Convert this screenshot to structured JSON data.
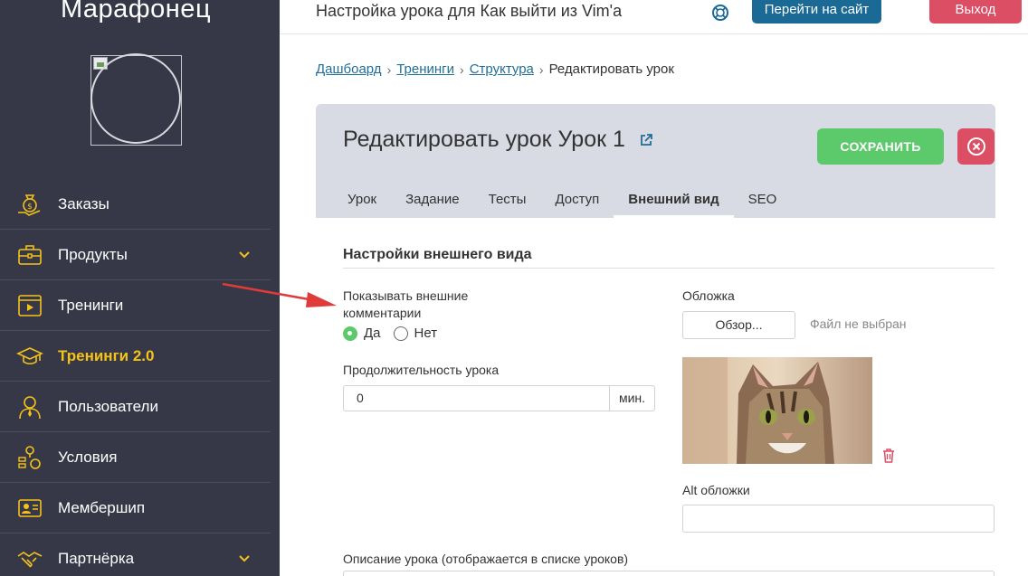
{
  "sidebar": {
    "brand": "Марафонец",
    "items": [
      {
        "label": "Заказы",
        "icon": "money-bag-icon",
        "active": false,
        "expandable": false
      },
      {
        "label": "Продукты",
        "icon": "briefcase-icon",
        "active": false,
        "expandable": true
      },
      {
        "label": "Тренинги",
        "icon": "video-player-icon",
        "active": false,
        "expandable": false
      },
      {
        "label": "Тренинги 2.0",
        "icon": "graduation-cap-icon",
        "active": true,
        "expandable": false
      },
      {
        "label": "Пользователи",
        "icon": "user-icon",
        "active": false,
        "expandable": false
      },
      {
        "label": "Условия",
        "icon": "conditions-icon",
        "active": false,
        "expandable": false
      },
      {
        "label": "Мембершип",
        "icon": "id-card-icon",
        "active": false,
        "expandable": false
      },
      {
        "label": "Партнёрка",
        "icon": "handshake-icon",
        "active": false,
        "expandable": true
      }
    ]
  },
  "topbar": {
    "title": "Настройка урока для Как выйти из Vim'a",
    "site_button": "Перейти на сайт",
    "exit_button": "Выход"
  },
  "breadcrumb": {
    "items": [
      "Дашбоард",
      "Тренинги",
      "Структура"
    ],
    "current": "Редактировать урок"
  },
  "card": {
    "title": "Редактировать урок Урок 1",
    "save_button": "СОХРАНИТЬ",
    "tabs": [
      "Урок",
      "Задание",
      "Тесты",
      "Доступ",
      "Внешний вид",
      "SEO"
    ],
    "active_tab": "Внешний вид"
  },
  "form": {
    "section_title": "Настройки внешнего вида",
    "comments_label_line1": "Показывать внешние",
    "comments_label_line2": "комментарии",
    "radio_yes": "Да",
    "radio_no": "Нет",
    "comments_value": "Да",
    "duration_label": "Продолжительность урока",
    "duration_value": "0",
    "duration_unit": "мин.",
    "cover_label": "Обложка",
    "browse_button": "Обзор...",
    "file_status": "Файл не выбран",
    "alt_label": "Alt обложки",
    "alt_value": "",
    "description_label": "Описание урока (отображается в списке уроков)"
  },
  "colors": {
    "sidebar_bg": "#363847",
    "active_item": "#f5c218",
    "site_button": "#1a6a95",
    "exit_button": "#dc4e63",
    "save_button": "#5cc96b",
    "card_header": "#d8dae4",
    "arrow": "#e03b3b"
  }
}
